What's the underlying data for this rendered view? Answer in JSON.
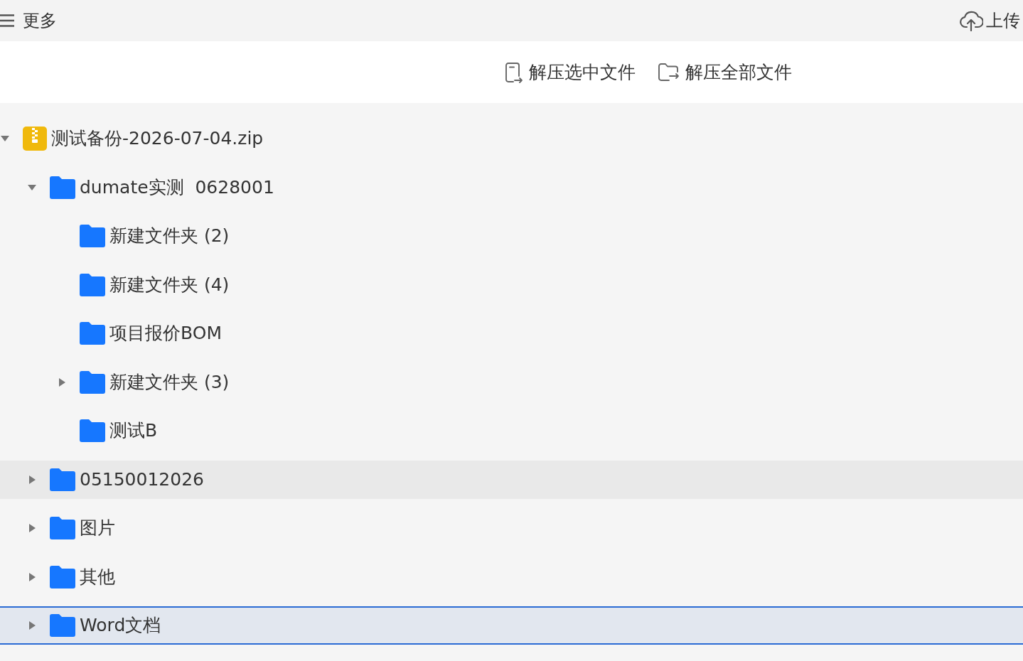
{
  "top_bar": {
    "menu_button": {
      "label": "更多"
    },
    "upload_button": {
      "label": "上传"
    }
  },
  "toolbar": {
    "buttons": [
      {
        "label": "解压选中文件",
        "kind": "document"
      },
      {
        "label": "解压全部文件",
        "kind": "folder"
      }
    ]
  },
  "tree": [
    {
      "label": "测试备份-2026-07-04.zip",
      "kind": "archive",
      "expanded": true,
      "selected": false,
      "hovered": false,
      "children": [
        {
          "label": "dumate实测  0628001",
          "kind": "folder",
          "expanded": true,
          "selected": false,
          "hovered": false,
          "children": [
            {
              "label": "新建文件夹 (2)",
              "kind": "folder",
              "selected": false,
              "hovered": false
            },
            {
              "label": "新建文件夹 (4)",
              "kind": "folder",
              "selected": false,
              "hovered": false
            },
            {
              "label": "项目报价BOM",
              "kind": "folder",
              "selected": false,
              "hovered": false
            },
            {
              "label": "新建文件夹 (3)",
              "kind": "folder",
              "expanded": false,
              "selected": false,
              "hovered": false
            },
            {
              "label": "测试B",
              "kind": "folder",
              "selected": false,
              "hovered": false
            }
          ]
        },
        {
          "label": "05150012026",
          "kind": "folder",
          "expanded": false,
          "selected": false,
          "hovered": true
        },
        {
          "label": "图片",
          "kind": "folder",
          "expanded": false,
          "selected": false,
          "hovered": false
        },
        {
          "label": "其他",
          "kind": "folder",
          "expanded": false,
          "selected": false,
          "hovered": false
        },
        {
          "label": "Word文档",
          "kind": "folder",
          "expanded": false,
          "selected": true,
          "hovered": false
        }
      ]
    }
  ]
}
